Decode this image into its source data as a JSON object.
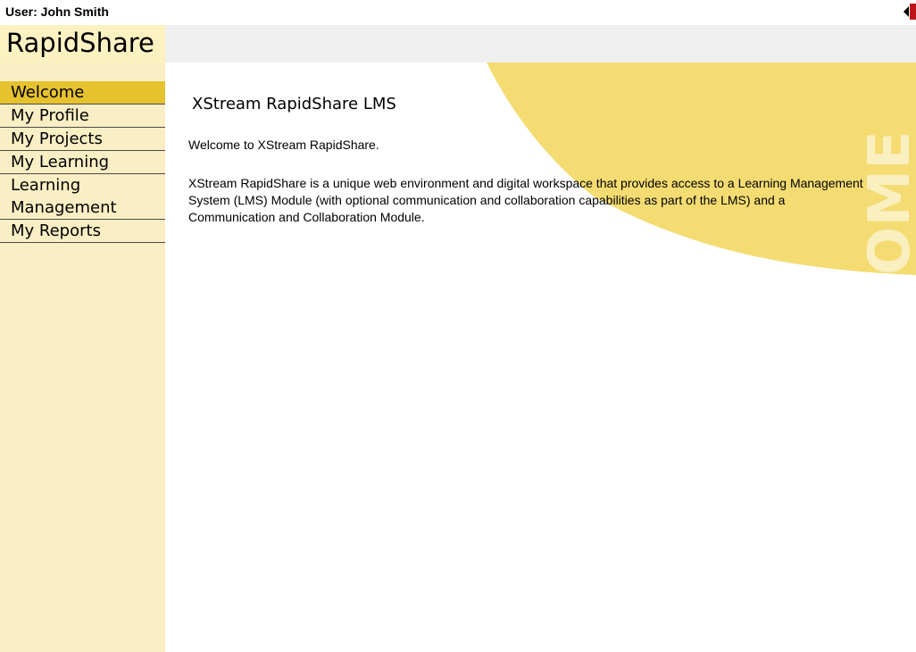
{
  "user": {
    "label": "User: John Smith"
  },
  "brand": {
    "name": "RapidShare"
  },
  "sidebar": {
    "items": [
      {
        "label": "Welcome",
        "active": true
      },
      {
        "label": "My Profile"
      },
      {
        "label": "My Projects"
      },
      {
        "label": "My Learning"
      },
      {
        "label": "Learning Management"
      },
      {
        "label": "My Reports"
      }
    ]
  },
  "main": {
    "title": "XStream RapidShare LMS",
    "welcome_line": "Welcome to XStream RapidShare.",
    "description": "XStream RapidShare is a unique web environment and digital workspace that provides access to a Learning Management System (LMS) Module (with optional communication and collaboration capabilities as part of the LMS) and a Communication and Collaboration Module.",
    "watermark": "WELCOME"
  },
  "colors": {
    "accent": "#e6c22f",
    "sidebar_bg": "#faeec4",
    "swoosh": "#f4dc72",
    "header_band": "#f0f0f0",
    "logout_red": "#c0141b"
  },
  "icons": {
    "logout": "logout-arrow-icon"
  }
}
